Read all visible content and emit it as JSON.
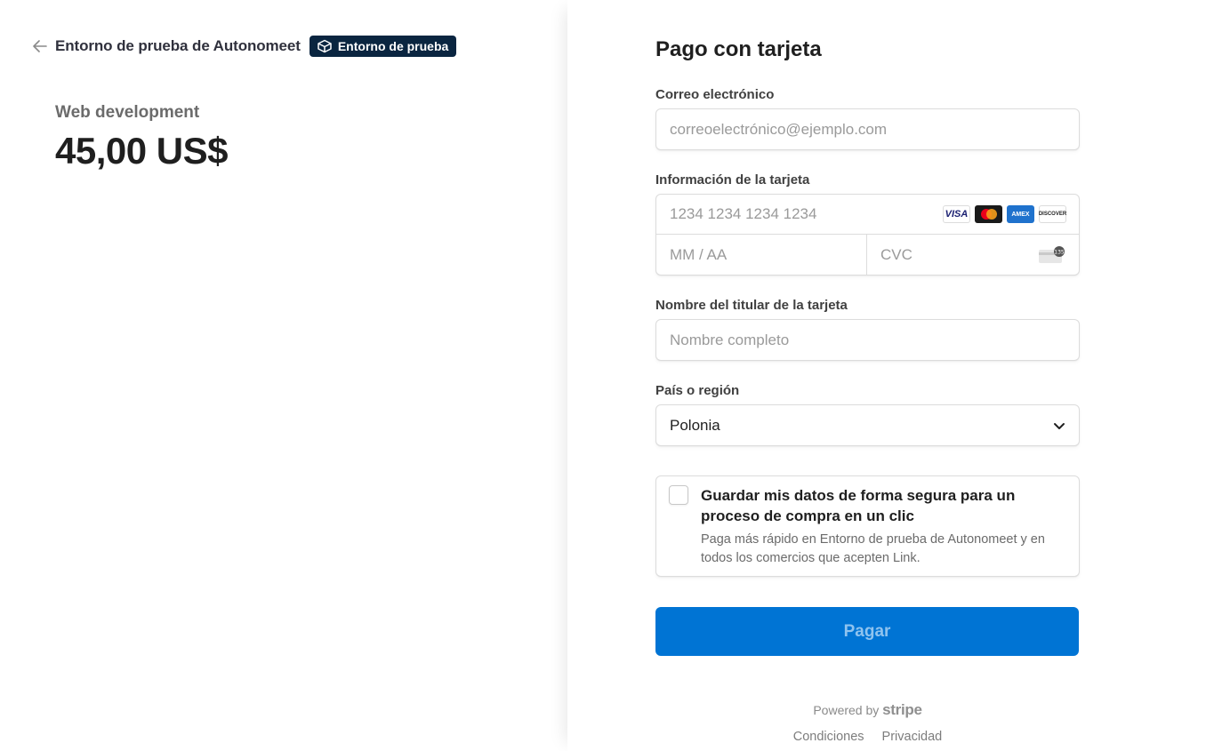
{
  "header": {
    "merchant_name": "Entorno de prueba de Autonomeet",
    "test_badge": "Entorno de prueba"
  },
  "product": {
    "name": "Web development",
    "price": "45,00 US$"
  },
  "form": {
    "title": "Pago con tarjeta",
    "email": {
      "label": "Correo electrónico",
      "placeholder": "correoelectrónico@ejemplo.com"
    },
    "card": {
      "label": "Información de la tarjeta",
      "number_placeholder": "1234 1234 1234 1234",
      "expiry_placeholder": "MM / AA",
      "cvc_placeholder": "CVC",
      "brands": [
        "VISA",
        "mastercard",
        "AMEX",
        "DISCOVER"
      ],
      "cvc_hint": "135"
    },
    "name": {
      "label": "Nombre del titular de la tarjeta",
      "placeholder": "Nombre completo"
    },
    "country": {
      "label": "País o región",
      "value": "Polonia"
    },
    "save": {
      "title": "Guardar mis datos de forma segura para un proceso de compra en un clic",
      "description": "Paga más rápido en Entorno de prueba de Autonomeet y en todos los comercios que acepten Link.",
      "checked": false
    },
    "pay_button": "Pagar"
  },
  "footer": {
    "powered_by": "Powered by",
    "stripe": "stripe",
    "terms": "Condiciones",
    "privacy": "Privacidad"
  },
  "colors": {
    "primary": "#0074d4",
    "badge_bg": "#0a2540"
  }
}
